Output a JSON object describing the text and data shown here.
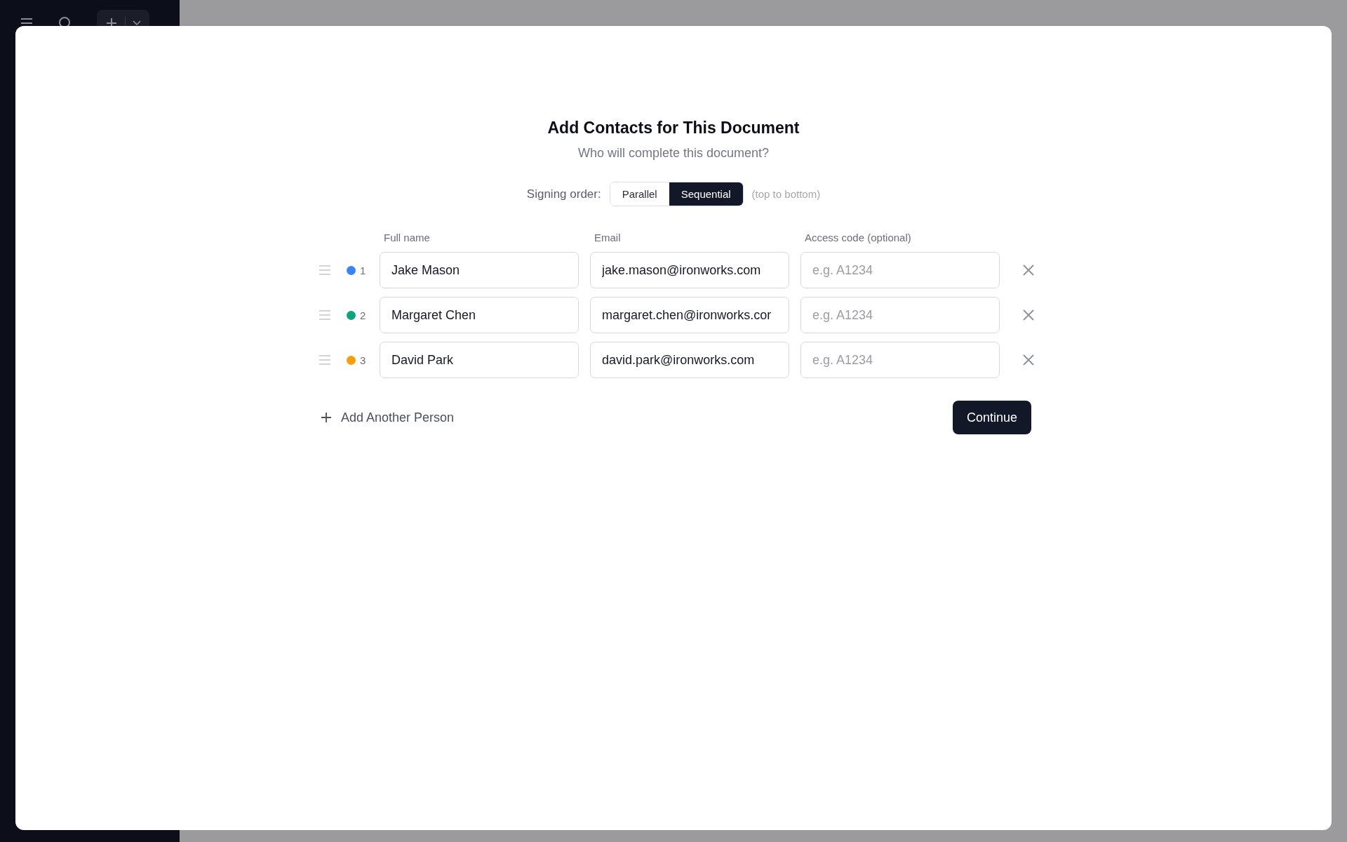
{
  "dialog": {
    "title": "Add Contacts for This Document",
    "subtitle": "Who will complete this document?",
    "signing_order": {
      "label": "Signing order:",
      "options": [
        {
          "label": "Parallel",
          "selected": false
        },
        {
          "label": "Sequential",
          "selected": true
        }
      ],
      "hint": "(top to bottom)"
    },
    "columns": [
      "Full name",
      "Email",
      "Access code (optional)"
    ],
    "contacts": [
      {
        "number": "1",
        "color": "#3b82f6",
        "name": "Jake Mason",
        "email": "jake.mason@ironworks.com",
        "access_code_placeholder": "e.g. A1234"
      },
      {
        "number": "2",
        "color": "#10a37f",
        "name": "Margaret Chen",
        "email": "margaret.chen@ironworks.cor",
        "access_code_placeholder": "e.g. A1234"
      },
      {
        "number": "3",
        "color": "#f59e0b",
        "name": "David Park",
        "email": "david.park@ironworks.com",
        "access_code_placeholder": "e.g. A1234"
      }
    ],
    "add_button": "Add Another Person",
    "continue_button": "Continue"
  }
}
